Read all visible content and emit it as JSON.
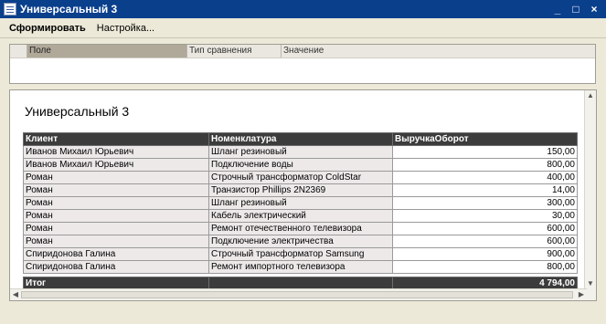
{
  "window": {
    "title": "Универсальный 3"
  },
  "toolbar": {
    "generate_label": "Сформировать",
    "settings_label": "Настройка..."
  },
  "filter": {
    "columns": [
      "Поле",
      "Тип сравнения",
      "Значение"
    ]
  },
  "report": {
    "title": "Универсальный 3",
    "columns": [
      "Клиент",
      "Номенклатура",
      "ВыручкаОборот"
    ],
    "rows": [
      [
        "Иванов Михаил Юрьевич",
        "Шланг резиновый",
        "150,00"
      ],
      [
        "Иванов Михаил Юрьевич",
        "Подключение воды",
        "800,00"
      ],
      [
        "Роман",
        "Строчный трансформатор ColdStar",
        "400,00"
      ],
      [
        "Роман",
        "Транзистор Phillips 2N2369",
        "14,00"
      ],
      [
        "Роман",
        "Шланг резиновый",
        "300,00"
      ],
      [
        "Роман",
        "Кабель электрический",
        "30,00"
      ],
      [
        "Роман",
        "Ремонт отечественного телевизора",
        "600,00"
      ],
      [
        "Роман",
        "Подключение электричества",
        "600,00"
      ],
      [
        "Спиридонова Галина",
        "Строчный трансформатор Samsung",
        "900,00"
      ],
      [
        "Спиридонова Галина",
        "Ремонт импортного телевизора",
        "800,00"
      ]
    ],
    "total": {
      "label": "Итог",
      "value": "4 794,00"
    }
  },
  "icons": {
    "app": "report-icon",
    "minimize": "minimize-icon",
    "maximize": "maximize-icon",
    "close": "close-icon"
  }
}
